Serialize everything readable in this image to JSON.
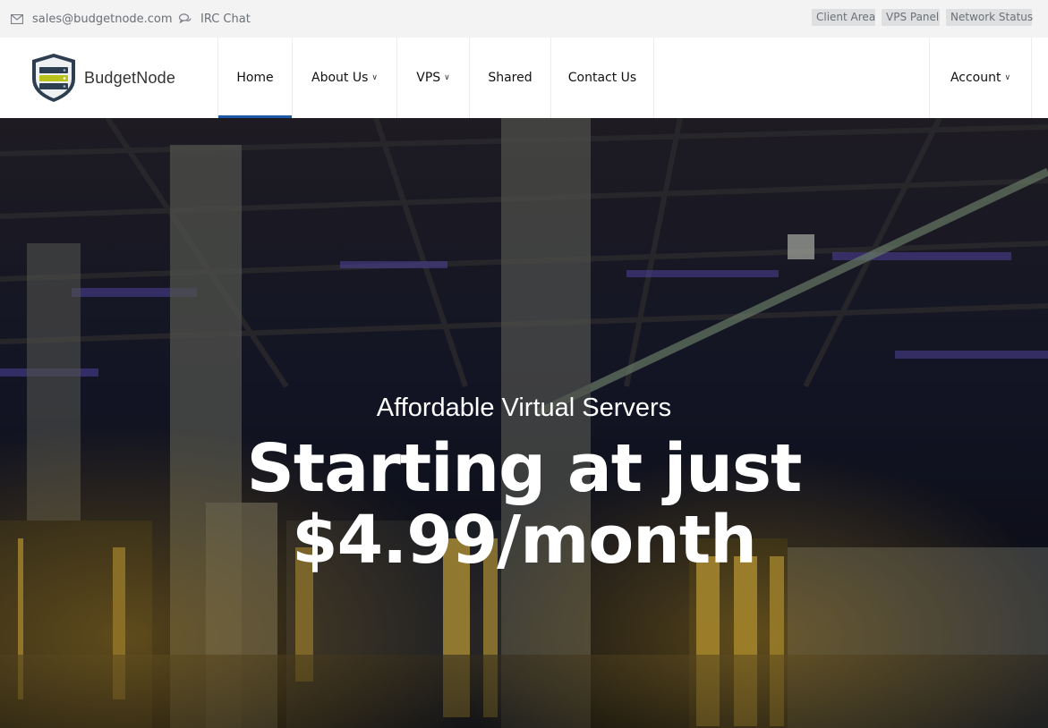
{
  "topbar": {
    "email": "sales@budgetnode.com",
    "irc": "IRC Chat",
    "links": [
      "Client Area",
      "VPS Panel",
      "Network Status"
    ]
  },
  "brand": {
    "name": "BudgetNode"
  },
  "nav": {
    "items": [
      {
        "label": "Home",
        "active": true
      },
      {
        "label": "About Us",
        "dropdown": true
      },
      {
        "label": "VPS",
        "dropdown": true
      },
      {
        "label": "Shared"
      },
      {
        "label": "Contact Us"
      }
    ],
    "account": "Account"
  },
  "hero": {
    "subtitle": "Affordable Virtual Servers",
    "title_line1": "Starting at just",
    "title_line2": "$4.99/month"
  },
  "colors": {
    "accent": "#1f5aa8",
    "topbar_bg": "#f3f3f4"
  },
  "icons": {
    "email": "envelope-icon",
    "irc": "chat-bubbles-icon",
    "caret": "chevron-down-icon"
  }
}
